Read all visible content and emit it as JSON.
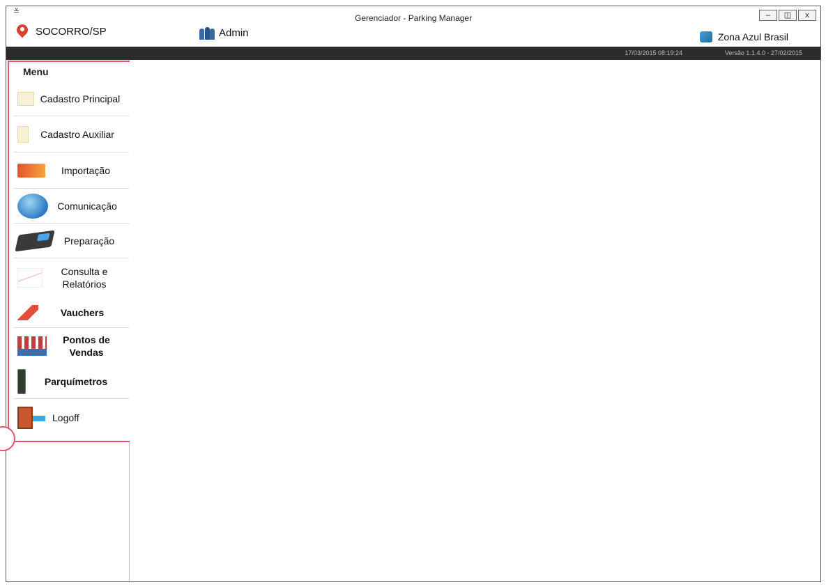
{
  "window": {
    "title": "Gerenciador - Parking Manager",
    "app_icon": "≚",
    "buttons": {
      "minimize": "–",
      "restore": "◫",
      "close": "x"
    }
  },
  "header": {
    "city": "SOCORRO/SP",
    "user": "Admin",
    "brand": "Zona Azul Brasil",
    "datetime": "17/03/2015 08:19:24",
    "version": "Versão 1.1.4.0 - 27/02/2015"
  },
  "sidebar": {
    "title": "Menu",
    "items": [
      {
        "label": "Cadastro Principal",
        "icon": "document-icon"
      },
      {
        "label": "Cadastro Auxiliar",
        "icon": "note-icon"
      },
      {
        "label": "Importação",
        "icon": "import-icon"
      },
      {
        "label": "Comunicação",
        "icon": "globe-icon"
      },
      {
        "label": "Preparação",
        "icon": "device-icon"
      },
      {
        "label": "Consulta e Relatórios",
        "icon": "chart-icon"
      },
      {
        "label": "Vauchers",
        "icon": "voucher-icon"
      },
      {
        "label": "Pontos de Vendas",
        "icon": "store-icon"
      },
      {
        "label": "Parquímetros",
        "icon": "parking-meter-icon"
      },
      {
        "label": "Logoff",
        "icon": "logoff-door-icon"
      }
    ]
  },
  "colors": {
    "highlight_border": "#e0556a",
    "dark_bar": "#2b2b2b",
    "pin": "#d9432f"
  }
}
